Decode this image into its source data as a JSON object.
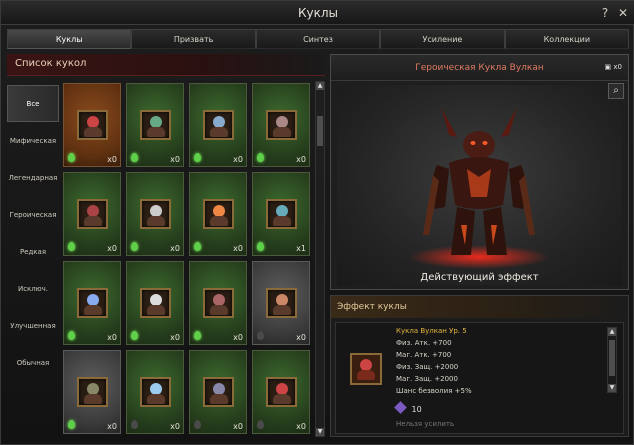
{
  "window": {
    "title": "Куклы"
  },
  "tabs": [
    {
      "label": "Куклы"
    },
    {
      "label": "Призвать"
    },
    {
      "label": "Синтез"
    },
    {
      "label": "Усиление"
    },
    {
      "label": "Коллекции"
    }
  ],
  "list": {
    "title": "Список кукол"
  },
  "categories": [
    {
      "label": "Все"
    },
    {
      "label": "Мифическая"
    },
    {
      "label": "Легендарная"
    },
    {
      "label": "Героическая"
    },
    {
      "label": "Редкая"
    },
    {
      "label": "Исключ."
    },
    {
      "label": "Улучшенная"
    },
    {
      "label": "Обычная"
    }
  ],
  "cards": [
    {
      "count": "x0",
      "frame": "orange",
      "gem": "lit",
      "color": "#c44"
    },
    {
      "count": "x0",
      "frame": "green",
      "gem": "lit",
      "color": "#6a8"
    },
    {
      "count": "x0",
      "frame": "green",
      "gem": "lit",
      "color": "#8ac"
    },
    {
      "count": "x0",
      "frame": "green",
      "gem": "lit",
      "color": "#a88"
    },
    {
      "count": "x0",
      "frame": "green",
      "gem": "lit",
      "color": "#a44"
    },
    {
      "count": "x0",
      "frame": "green",
      "gem": "lit",
      "color": "#ccc"
    },
    {
      "count": "x0",
      "frame": "green",
      "gem": "lit",
      "color": "#e84"
    },
    {
      "count": "x1",
      "frame": "green",
      "gem": "lit",
      "color": "#6ab"
    },
    {
      "count": "x0",
      "frame": "green",
      "gem": "lit",
      "color": "#8ae"
    },
    {
      "count": "x0",
      "frame": "green",
      "gem": "lit",
      "color": "#ddd"
    },
    {
      "count": "x0",
      "frame": "green",
      "gem": "lit",
      "color": "#a66"
    },
    {
      "count": "x0",
      "frame": "gray",
      "gem": "dim",
      "color": "#c86"
    },
    {
      "count": "x0",
      "frame": "gray",
      "gem": "lit",
      "color": "#886"
    },
    {
      "count": "x0",
      "frame": "green",
      "gem": "dim",
      "color": "#9ce"
    },
    {
      "count": "x0",
      "frame": "green",
      "gem": "dim",
      "color": "#88a"
    },
    {
      "count": "x0",
      "frame": "green",
      "gem": "dim",
      "color": "#c44"
    }
  ],
  "preview": {
    "title": "Героическая Кукла Вулкан",
    "bag_count": "x0",
    "active_effect_label": "Действующий эффект"
  },
  "effect": {
    "header": "Эффект куклы",
    "name": "Кукла Вулкан Ур. 5",
    "stats": [
      "Физ. Атк. +700",
      "Маг. Атк. +700",
      "Физ. Защ. +2000",
      "Маг. Защ. +2000",
      "Шанс безволия +5%"
    ],
    "level": "10",
    "note": "Нельзя усилить"
  },
  "colors": {
    "accent": "#e07a62",
    "gold": "#e6b840",
    "gem": "#5fd04a"
  }
}
